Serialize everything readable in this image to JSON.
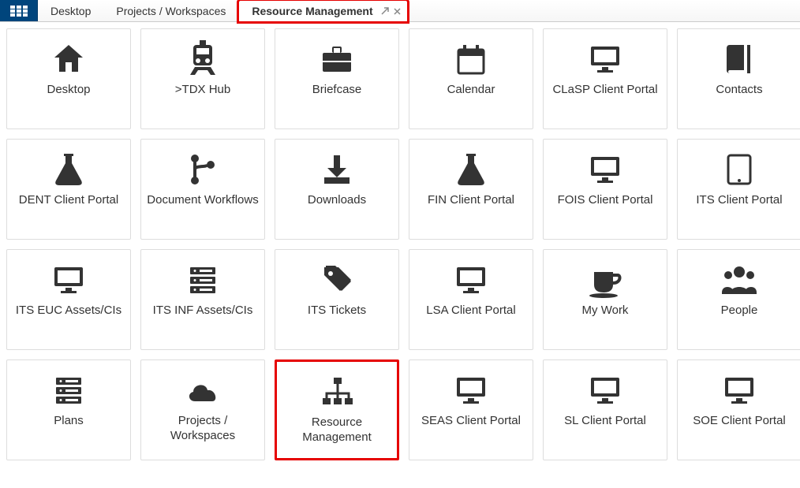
{
  "tabs": {
    "items": [
      {
        "label": "Desktop",
        "active": false
      },
      {
        "label": "Projects / Workspaces",
        "active": false
      },
      {
        "label": "Resource Management",
        "active": true,
        "highlighted": true
      }
    ]
  },
  "tiles": [
    {
      "id": "desktop",
      "label": "Desktop",
      "icon": "home"
    },
    {
      "id": "tdx-hub",
      "label": ">TDX Hub",
      "icon": "train"
    },
    {
      "id": "briefcase",
      "label": "Briefcase",
      "icon": "briefcase"
    },
    {
      "id": "calendar",
      "label": "Calendar",
      "icon": "calendar"
    },
    {
      "id": "clasp-client-portal",
      "label": "CLaSP Client Portal",
      "icon": "monitor"
    },
    {
      "id": "contacts",
      "label": "Contacts",
      "icon": "book"
    },
    {
      "id": "dent-client-portal",
      "label": "DENT Client Portal",
      "icon": "flask"
    },
    {
      "id": "document-workflows",
      "label": "Document Workflows",
      "icon": "branch"
    },
    {
      "id": "downloads",
      "label": "Downloads",
      "icon": "download"
    },
    {
      "id": "fin-client-portal",
      "label": "FIN Client Portal",
      "icon": "flask"
    },
    {
      "id": "fois-client-portal",
      "label": "FOIS Client Portal",
      "icon": "monitor"
    },
    {
      "id": "its-client-portal",
      "label": "ITS Client Portal",
      "icon": "tablet"
    },
    {
      "id": "its-euc-assets",
      "label": "ITS EUC Assets/CIs",
      "icon": "monitor"
    },
    {
      "id": "its-inf-assets",
      "label": "ITS INF Assets/CIs",
      "icon": "server"
    },
    {
      "id": "its-tickets",
      "label": "ITS Tickets",
      "icon": "tag"
    },
    {
      "id": "lsa-client-portal",
      "label": "LSA Client Portal",
      "icon": "monitor"
    },
    {
      "id": "my-work",
      "label": "My Work",
      "icon": "coffee"
    },
    {
      "id": "people",
      "label": "People",
      "icon": "people"
    },
    {
      "id": "plans",
      "label": "Plans",
      "icon": "server"
    },
    {
      "id": "projects-workspaces",
      "label": "Projects / Workspaces",
      "icon": "cloud"
    },
    {
      "id": "resource-management",
      "label": "Resource Management",
      "icon": "sitemap",
      "highlighted": true
    },
    {
      "id": "seas-client-portal",
      "label": "SEAS Client Portal",
      "icon": "monitor"
    },
    {
      "id": "sl-client-portal",
      "label": "SL Client Portal",
      "icon": "monitor"
    },
    {
      "id": "soe-client-portal",
      "label": "SOE Client Portal",
      "icon": "monitor"
    }
  ]
}
